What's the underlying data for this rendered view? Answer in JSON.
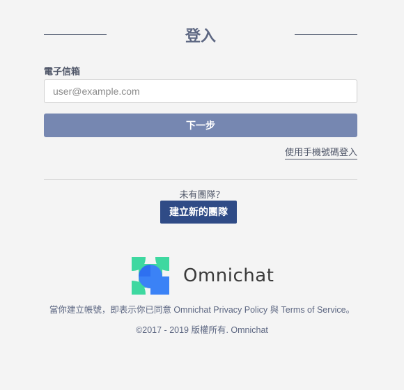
{
  "header": {
    "title": "登入"
  },
  "form": {
    "email_label": "電子信箱",
    "email_placeholder": "user@example.com",
    "email_value": "",
    "next_label": "下一步",
    "phone_login_link": "使用手機號碼登入"
  },
  "team": {
    "no_team_text": "未有團隊？",
    "create_team_label": "建立新的團隊"
  },
  "brand": {
    "name": "Omnichat",
    "logo_icon": "omnichat-logo-icon",
    "colors": {
      "green": "#3ed8a0",
      "blue": "#3b82f6",
      "dark_blue": "#2563eb"
    }
  },
  "footer": {
    "agreement_prefix": "當你建立帳號，即表示你已同意 Omnichat ",
    "privacy_link": "Privacy Policy",
    "agreement_and": " 與 ",
    "terms_link": "Terms of Service",
    "agreement_suffix": "。",
    "copyright": "©2017 - 2019 版權所有. Omnichat"
  },
  "colors": {
    "primary_button": "#7687b1",
    "create_button": "#2f4b86",
    "background": "#f4f4f4"
  }
}
